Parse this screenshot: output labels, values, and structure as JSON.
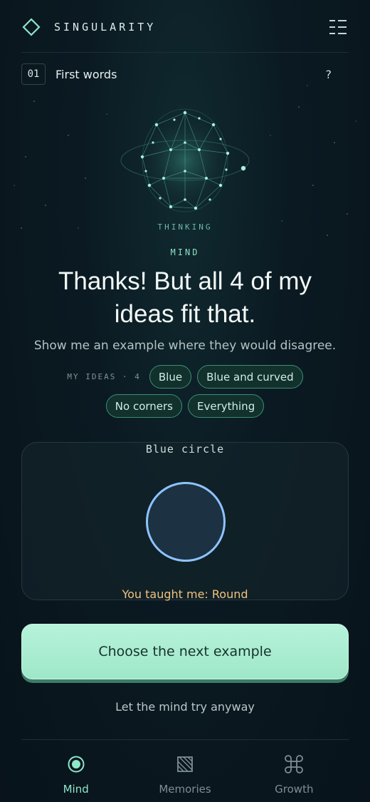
{
  "header": {
    "brand": "SINGULARITY",
    "logo_icon": "diamond-icon",
    "menu_icon": "menu-icon"
  },
  "level": {
    "number": "01",
    "title": "First words",
    "help": "?"
  },
  "mind": {
    "status": "THINKING",
    "speaker": "MIND",
    "message": "Thanks! But all 4 of my ideas fit that.",
    "prompt": "Show me an example where they would disagree."
  },
  "ideas": {
    "label": "MY IDEAS · 4",
    "items": [
      "Blue",
      "Blue and curved",
      "No corners",
      "Everything"
    ]
  },
  "example": {
    "title": "Blue circle",
    "taught": "You taught me: Round"
  },
  "actions": {
    "primary": "Choose the next example",
    "secondary": "Let the mind try anyway"
  },
  "nav": {
    "items": [
      {
        "label": "Mind",
        "icon": "target-icon",
        "active": true
      },
      {
        "label": "Memories",
        "icon": "memories-icon",
        "active": false
      },
      {
        "label": "Growth",
        "icon": "command-icon",
        "active": false
      }
    ]
  },
  "colors": {
    "accent": "#9fe7c9",
    "speaker": "#8fe0c5",
    "taught": "#f0c27d",
    "shape_stroke": "#8ec3ff",
    "background": "#0b1a22"
  }
}
